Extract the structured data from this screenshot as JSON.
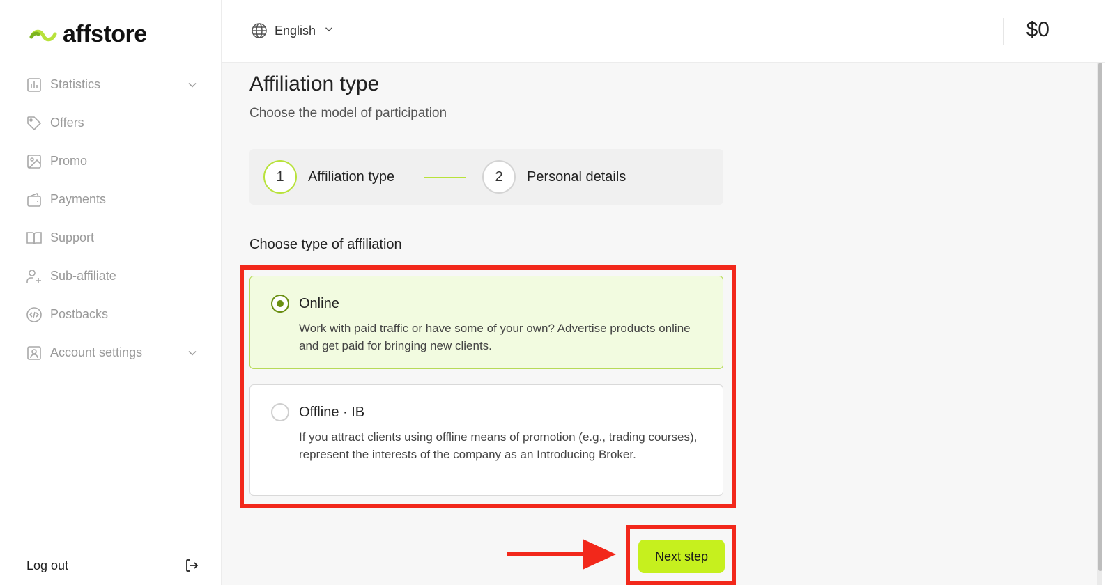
{
  "brand": {
    "name": "affstore",
    "accent": "#b8e23b"
  },
  "sidebar": {
    "items": [
      {
        "label": "Statistics",
        "icon": "bar-chart-icon",
        "has_submenu": true
      },
      {
        "label": "Offers",
        "icon": "tag-icon",
        "has_submenu": false
      },
      {
        "label": "Promo",
        "icon": "image-icon",
        "has_submenu": false
      },
      {
        "label": "Payments",
        "icon": "wallet-icon",
        "has_submenu": false
      },
      {
        "label": "Support",
        "icon": "book-icon",
        "has_submenu": false
      },
      {
        "label": "Sub-affiliate",
        "icon": "user-add-icon",
        "has_submenu": false
      },
      {
        "label": "Postbacks",
        "icon": "code-circle-icon",
        "has_submenu": false
      },
      {
        "label": "Account settings",
        "icon": "user-square-icon",
        "has_submenu": true
      }
    ],
    "logout_label": "Log out"
  },
  "header": {
    "language": "English",
    "balance": "$0"
  },
  "main": {
    "title": "Affiliation type",
    "subtitle": "Choose the model of participation",
    "steps": [
      {
        "number": "1",
        "label": "Affiliation type",
        "active": true
      },
      {
        "number": "2",
        "label": "Personal details",
        "active": false
      }
    ],
    "section_label": "Choose type of affiliation",
    "options": [
      {
        "title": "Online",
        "description": "Work with paid traffic or have some of your own? Advertise products online and get paid for bringing new clients.",
        "selected": true
      },
      {
        "title": "Offline · IB",
        "description": "If you attract clients using offline means of promotion (e.g., trading courses), represent the interests of the company as an Introducing Broker.",
        "selected": false
      }
    ],
    "next_button": "Next step"
  },
  "annotation_color": "#f2281b"
}
